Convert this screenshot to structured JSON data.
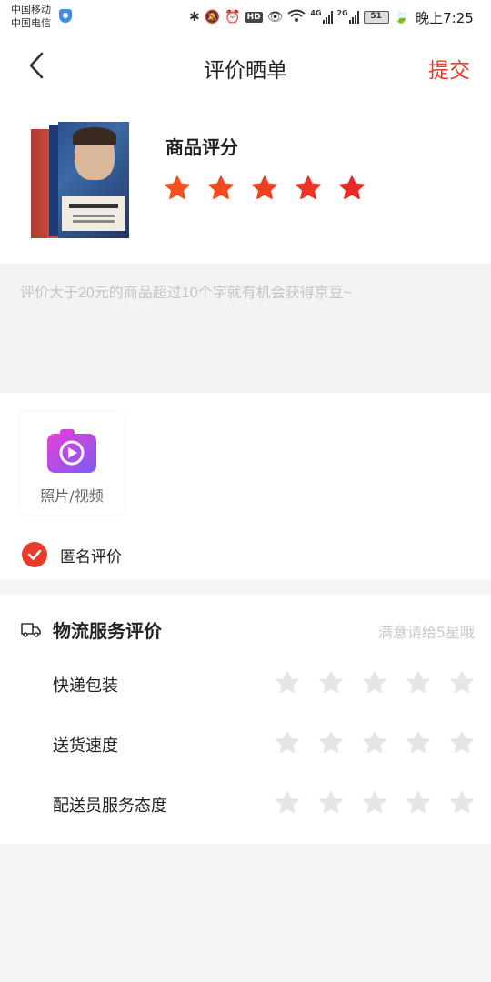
{
  "status_bar": {
    "carrier_1": "中国移动",
    "carrier_2": "中国电信",
    "hd_badge": "HD",
    "net_4g": "4G",
    "net_2g": "2G",
    "battery": "51",
    "time": "晚上7:25"
  },
  "nav": {
    "title": "评价晒单",
    "submit_label": "提交",
    "accent_color": "#e93b2c"
  },
  "product": {
    "rating_label": "商品评分",
    "rating": 5,
    "rating_max": 5,
    "star_colors": [
      "#f4511e",
      "#f24a1f",
      "#ef3f22",
      "#ec3325",
      "#e72a26"
    ]
  },
  "comment": {
    "value": "",
    "placeholder": "评价大于20元的商品超过10个字就有机会获得京豆~"
  },
  "media": {
    "upload_label": "照片/视频",
    "anonymous_label": "匿名评价",
    "anonymous_checked": true
  },
  "logistics": {
    "title": "物流服务评价",
    "hint": "满意请给5星哦",
    "empty_star_color": "#e6e6ea",
    "items": [
      {
        "label": "快递包装",
        "rating": 0
      },
      {
        "label": "送货速度",
        "rating": 0
      },
      {
        "label": "配送员服务态度",
        "rating": 0
      }
    ]
  }
}
